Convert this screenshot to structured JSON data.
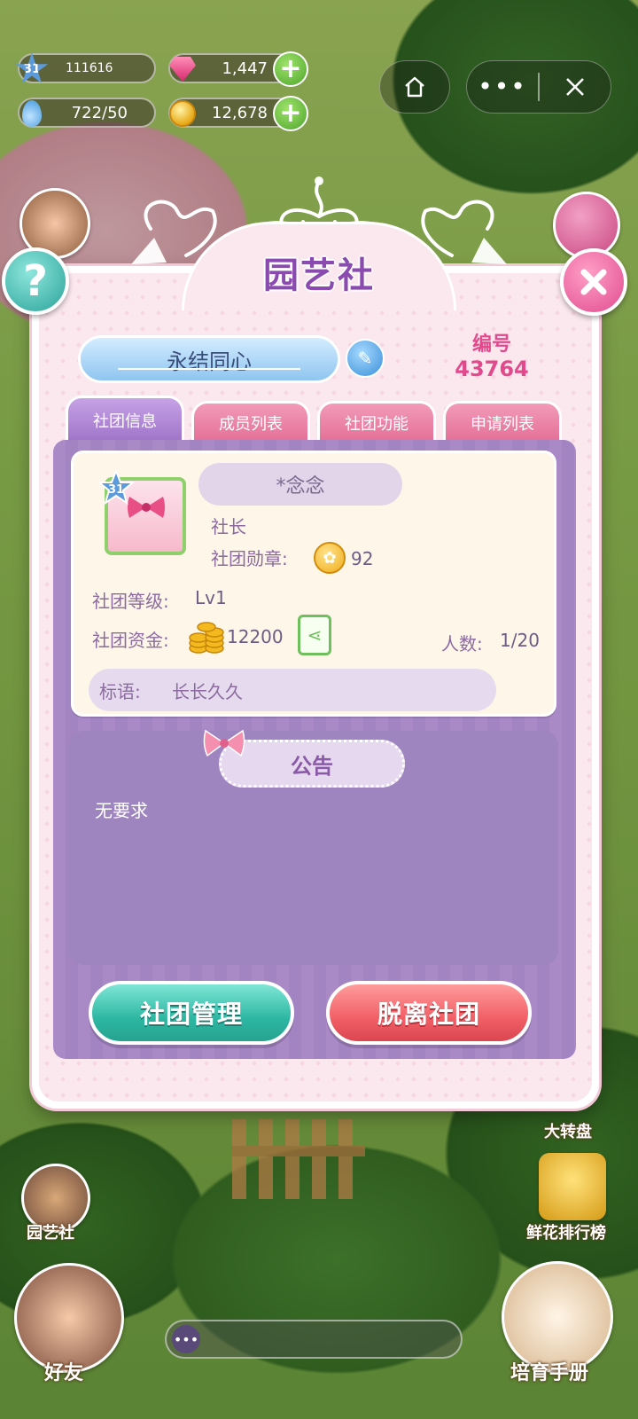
{
  "hud": {
    "level": "31",
    "exp": "111616",
    "gems": "1,447",
    "water": "722/50",
    "gold": "12,678"
  },
  "side": {
    "left_labels": [
      "园艺社",
      "好友"
    ],
    "right_labels": [
      "大转盘",
      "鲜花排行榜",
      "培育手册"
    ]
  },
  "modal": {
    "title": "园艺社",
    "club_name": "永结同心",
    "id_label": "编号",
    "id_value": "43764",
    "tabs": [
      "社团信息",
      "成员列表",
      "社团功能",
      "申请列表"
    ],
    "member": {
      "level": "31",
      "nickname": "*念念",
      "role": "社长",
      "medal_label": "社团勋章:",
      "medal_value": "92"
    },
    "club_level_label": "社团等级:",
    "club_level_value": "Lv1",
    "funds_label": "社团资金:",
    "funds_value": "12200",
    "members_label": "人数:",
    "members_value": "1/20",
    "slogan_label": "标语:",
    "slogan_value": "长长久久",
    "notice_title": "公告",
    "notice_text": "无要求",
    "btn_manage": "社团管理",
    "btn_leave": "脱离社团"
  },
  "colors": {
    "title": "#8a4ab0",
    "accent_pink": "#e2498c",
    "panel_purple": "#a98ac7",
    "btn_teal": "#2db7a3",
    "btn_red": "#f15f66"
  }
}
